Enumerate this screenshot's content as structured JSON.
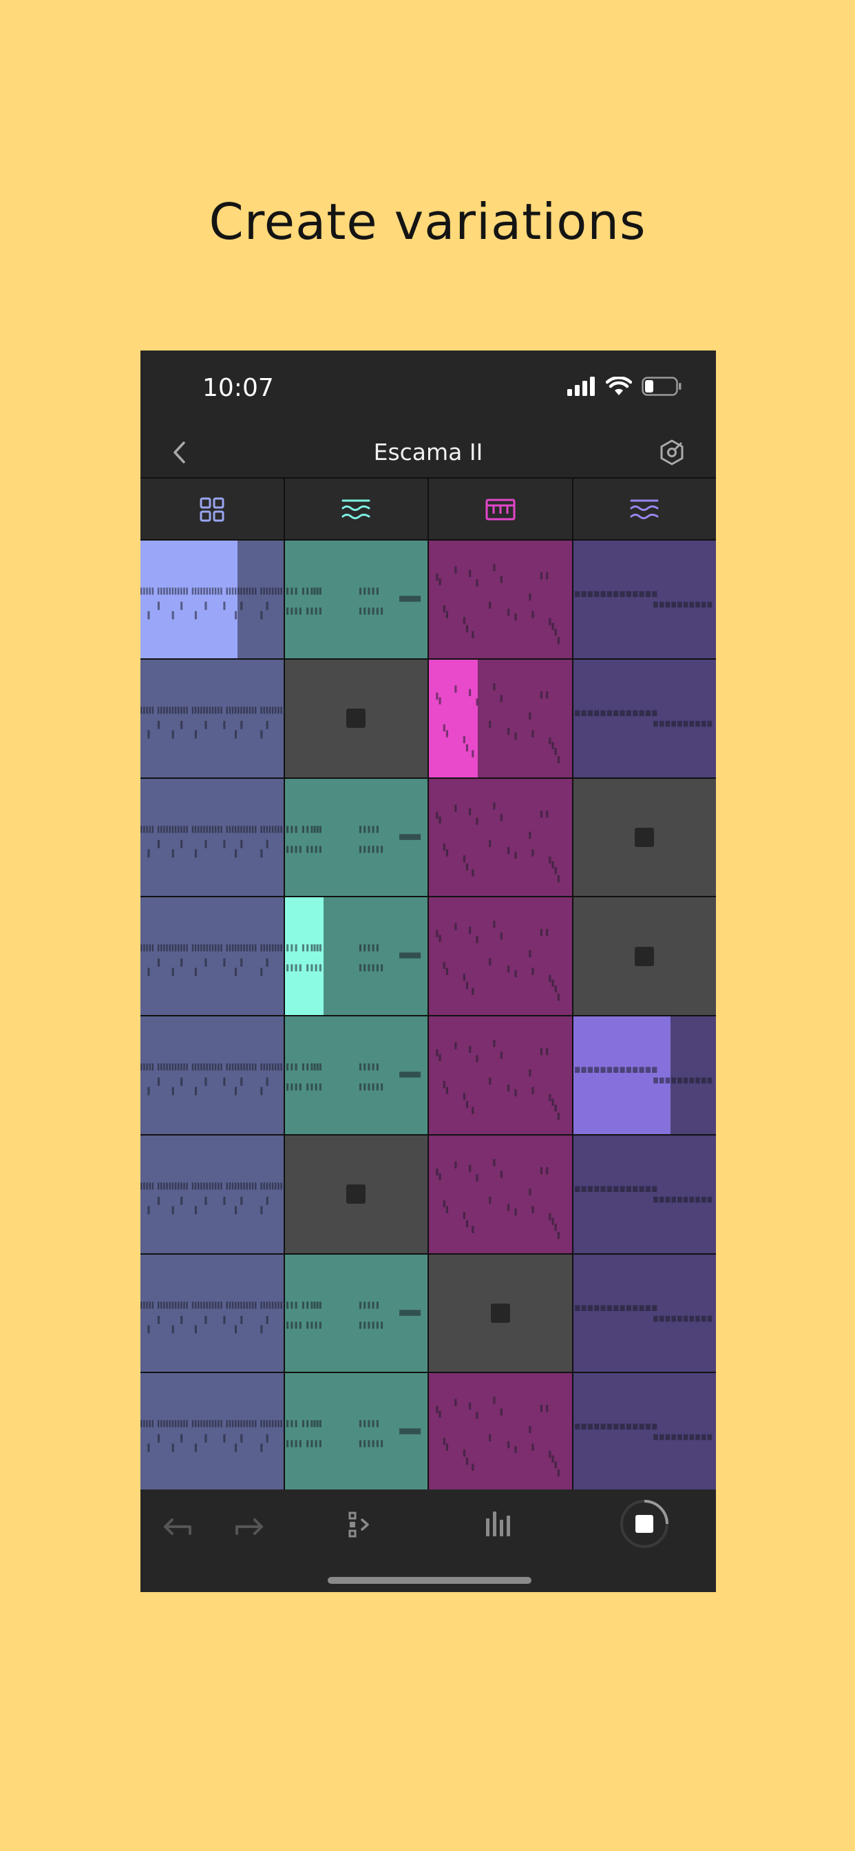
{
  "headline": "Create variations",
  "status_bar": {
    "time": "10:07"
  },
  "nav": {
    "title": "Escama II"
  },
  "tabs": [
    {
      "icon": "grid-icon",
      "color": "#9AA5F0"
    },
    {
      "icon": "wave-layers-icon",
      "color": "#7FF3E2"
    },
    {
      "icon": "keyboard-icon",
      "color": "#E246C9"
    },
    {
      "icon": "wave-layers-icon",
      "color": "#9A86F0"
    }
  ],
  "colors": {
    "background": "#FFD97A",
    "column_cells": [
      "#5A618F",
      "#4E8E82",
      "#7C2E6E",
      "#4E4279"
    ],
    "active_highlights": [
      "#9AA7F8",
      "#8CFBE4",
      "#E84ACB",
      "#8671DC"
    ],
    "stopped_cell": "#4A4A4A"
  },
  "grid": [
    [
      {
        "state": "playing",
        "progress": 0.68
      },
      {
        "state": "clip"
      },
      {
        "state": "clip"
      },
      {
        "state": "clip"
      }
    ],
    [
      {
        "state": "clip"
      },
      {
        "state": "stop"
      },
      {
        "state": "playing",
        "progress": 0.34
      },
      {
        "state": "clip"
      }
    ],
    [
      {
        "state": "clip"
      },
      {
        "state": "clip"
      },
      {
        "state": "clip"
      },
      {
        "state": "stop"
      }
    ],
    [
      {
        "state": "clip"
      },
      {
        "state": "playing",
        "progress": 0.27
      },
      {
        "state": "clip"
      },
      {
        "state": "stop"
      }
    ],
    [
      {
        "state": "clip"
      },
      {
        "state": "clip"
      },
      {
        "state": "clip"
      },
      {
        "state": "playing",
        "progress": 0.68
      }
    ],
    [
      {
        "state": "clip"
      },
      {
        "state": "stop"
      },
      {
        "state": "clip"
      },
      {
        "state": "clip"
      }
    ],
    [
      {
        "state": "clip"
      },
      {
        "state": "clip"
      },
      {
        "state": "stop"
      },
      {
        "state": "clip"
      }
    ],
    [
      {
        "state": "clip"
      },
      {
        "state": "clip"
      },
      {
        "state": "clip"
      },
      {
        "state": "clip"
      }
    ]
  ],
  "toolbar": [
    {
      "name": "undo-button",
      "icon": "undo-icon"
    },
    {
      "name": "redo-button",
      "icon": "redo-icon"
    },
    {
      "name": "scenes-button",
      "icon": "scene-list-icon"
    },
    {
      "name": "mixer-button",
      "icon": "mixer-icon"
    },
    {
      "name": "stop-all-button",
      "icon": "stop-icon"
    }
  ]
}
